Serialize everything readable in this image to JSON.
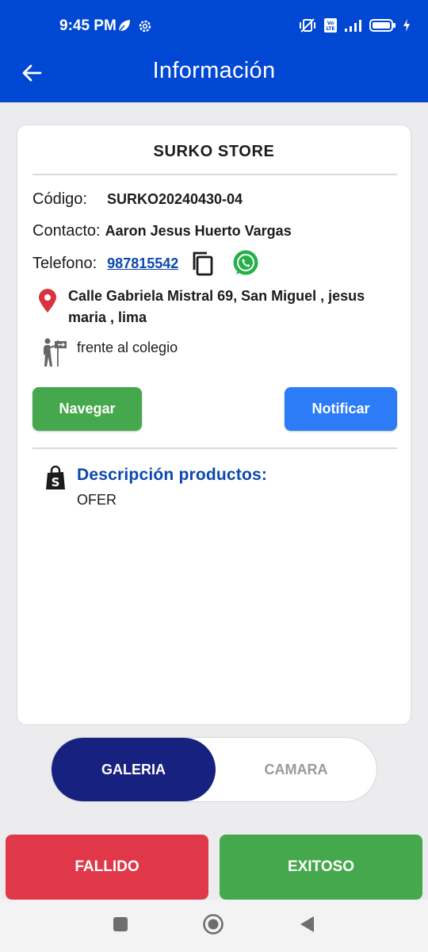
{
  "status_bar": {
    "time": "9:45 PM",
    "icons": [
      "leaf-icon",
      "gear-icon",
      "vibrate-off-icon",
      "volte-icon",
      "signal-icon",
      "battery-icon",
      "charging-icon"
    ]
  },
  "app_bar": {
    "title": "Información",
    "back_icon": "arrow-left-icon"
  },
  "card": {
    "store_name": "SURKO STORE",
    "code_label": "Código:",
    "code_value": "SURKO20240430-04",
    "contact_label": "Contacto:",
    "contact_value": "Aaron Jesus Huerto Vargas",
    "phone_label": "Telefono:",
    "phone_value": "987815542",
    "address": "Calle Gabriela Mistral 69, San Miguel , jesus maria , lima",
    "reference": "frente al colegio",
    "navigate_label": "Navegar",
    "notify_label": "Notificar",
    "description_title": "Descripción productos:",
    "description_value": "OFER"
  },
  "photo_toggle": {
    "gallery_label": "GALERIA",
    "camera_label": "CAMARA",
    "selected": "GALERIA"
  },
  "actions": {
    "fail_label": "FALLIDO",
    "success_label": "EXITOSO"
  },
  "colors": {
    "primary": "#0047d3",
    "green": "#46a84c",
    "blue_button": "#2b7cf6",
    "red": "#e03849",
    "toggle_selected": "#17217f",
    "link": "#0d47b0",
    "pin_red": "#d9333f",
    "whatsapp": "#25b04a"
  },
  "system_nav": {
    "icons": [
      "square-icon",
      "circle-home-icon",
      "triangle-back-icon"
    ]
  }
}
